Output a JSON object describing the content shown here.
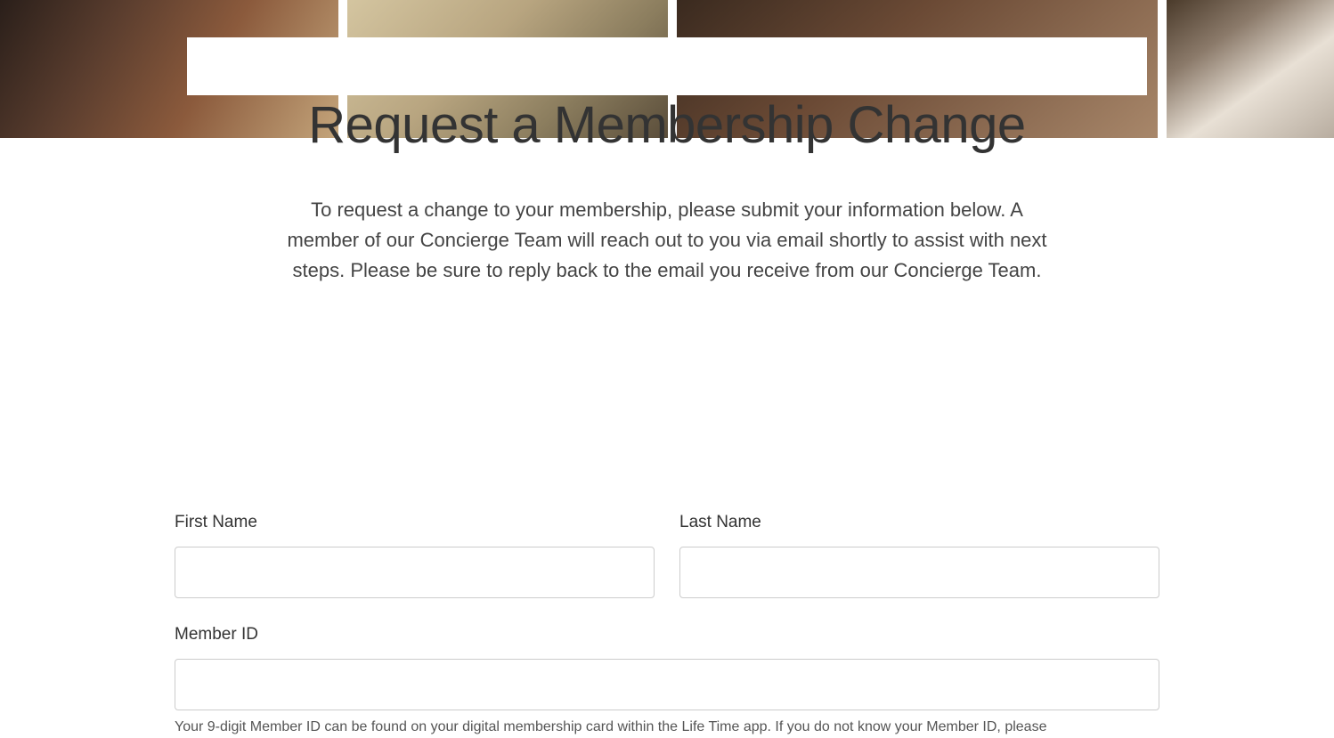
{
  "page": {
    "title": "Request a Membership Change",
    "description": "To request a change to your membership, please submit your information below. A member of our Concierge Team will reach out to you via email shortly to assist with next steps. Please be sure to reply back to the email you receive from our Concierge Team."
  },
  "form": {
    "firstName": {
      "label": "First Name",
      "value": ""
    },
    "lastName": {
      "label": "Last Name",
      "value": ""
    },
    "memberId": {
      "label": "Member ID",
      "value": "",
      "helper": "Your 9-digit Member ID can be found on your digital membership card within the Life Time app. If you do not know your Member ID, please"
    }
  }
}
